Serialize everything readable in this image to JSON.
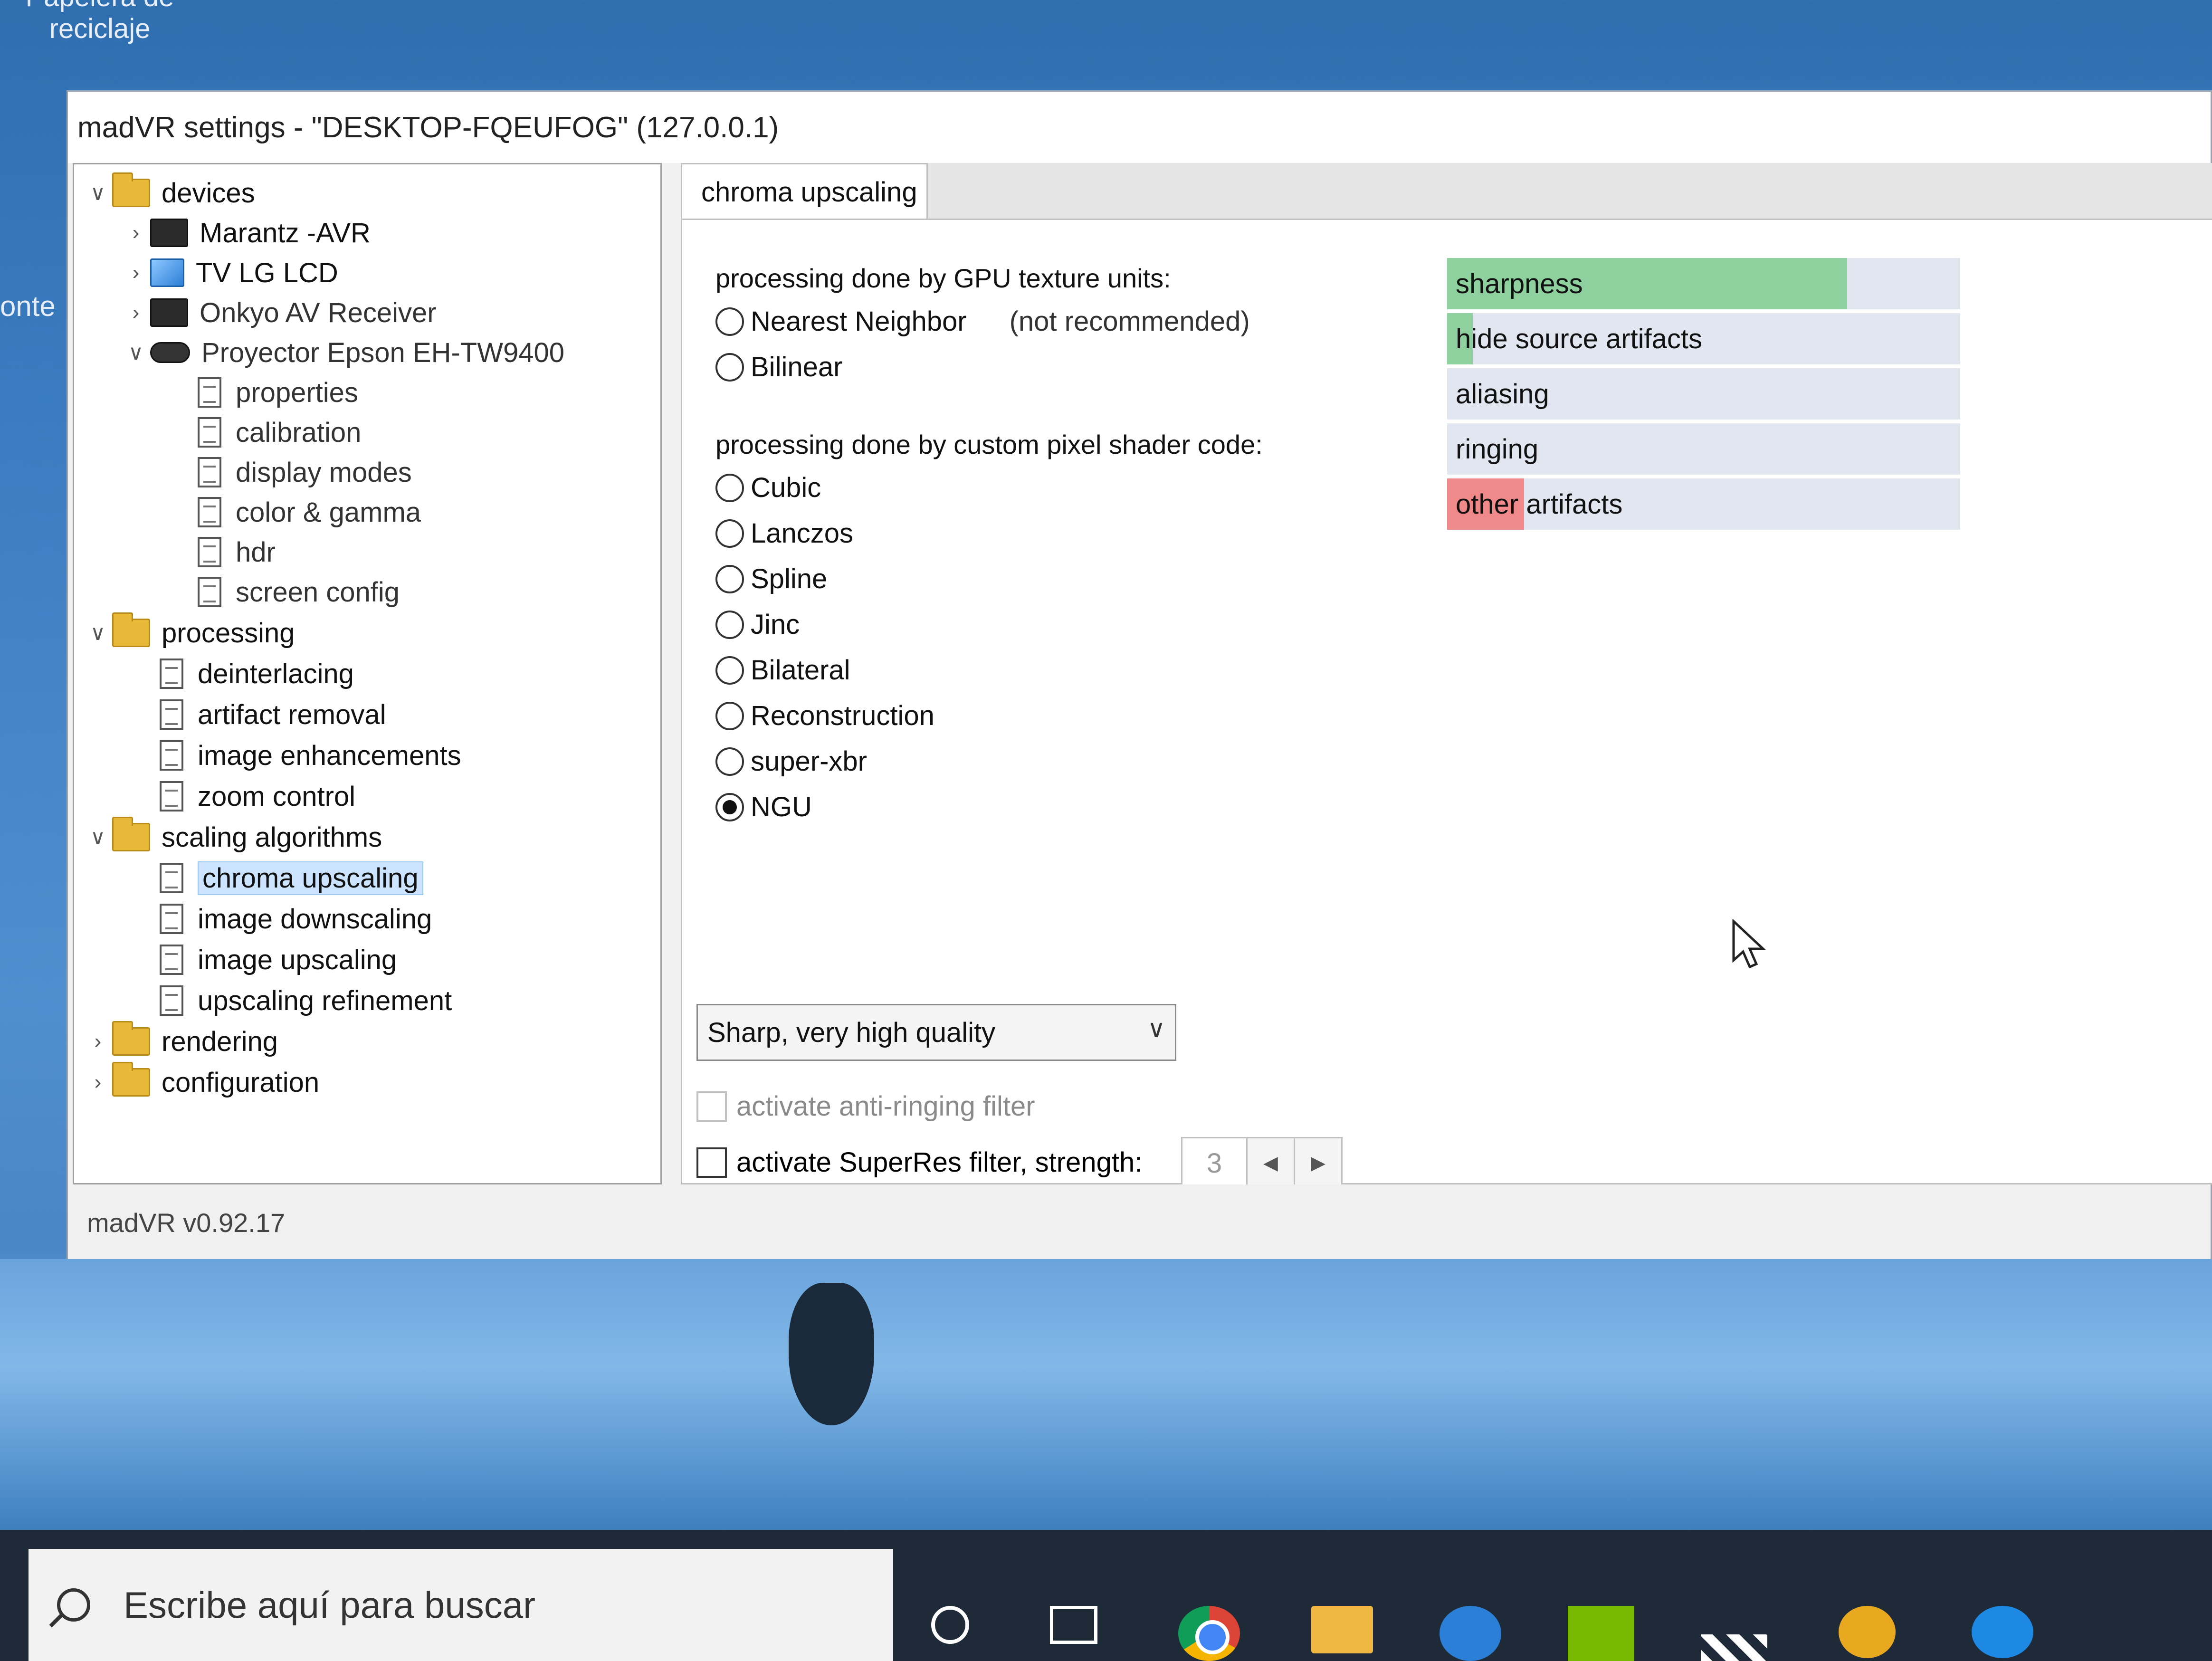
{
  "desktop": {
    "recycle_bin_label_line1": "Papelera de",
    "recycle_bin_label_line2": "reciclaje",
    "cut_label": "onte"
  },
  "window": {
    "title": "madVR settings - \"DESKTOP-FQEUFOG\" (127.0.0.1)",
    "status": "madVR v0.92.17"
  },
  "tree": {
    "devices": "devices",
    "marantz": "Marantz -AVR",
    "tv": "TV LG LCD",
    "onkyo": "Onkyo AV Receiver",
    "proyector": "Proyector Epson EH-TW9400",
    "properties": "properties",
    "calibration": "calibration",
    "display_modes": "display modes",
    "color_gamma": "color & gamma",
    "hdr": "hdr",
    "screen_config": "screen config",
    "processing": "processing",
    "deinterlacing": "deinterlacing",
    "artifact_removal": "artifact removal",
    "image_enhancements": "image enhancements",
    "zoom_control": "zoom control",
    "scaling_algorithms": "scaling algorithms",
    "chroma_upscaling": "chroma upscaling",
    "image_downscaling": "image downscaling",
    "image_upscaling": "image upscaling",
    "upscaling_refinement": "upscaling refinement",
    "rendering": "rendering",
    "configuration": "configuration"
  },
  "panel": {
    "tab": "chroma upscaling",
    "gpu_heading": "processing done by GPU texture units:",
    "nearest": "Nearest Neighbor",
    "nearest_note": "(not recommended)",
    "bilinear": "Bilinear",
    "shader_heading": "processing done by custom pixel shader code:",
    "cubic": "Cubic",
    "lanczos": "Lanczos",
    "spline": "Spline",
    "jinc": "Jinc",
    "bilateral": "Bilateral",
    "reconstruction": "Reconstruction",
    "superxbr": "super-xbr",
    "ngu": "NGU",
    "selected_algorithm": "NGU",
    "quality": "Sharp, very high quality",
    "anti_ringing": "activate anti-ringing filter",
    "superres": "activate SuperRes filter, strength:",
    "strength": "3"
  },
  "meters": {
    "sharpness": "sharpness",
    "sharpness_level": 0.78,
    "hide_source_artifacts": "hide source artifacts",
    "hide_level": 0.05,
    "aliasing": "aliasing",
    "ringing": "ringing",
    "other_artifacts": "other artifacts",
    "other_level": 0.15,
    "colors": {
      "good": "#8fd19e",
      "bad": "#f08a8a",
      "track": "#e2e6f0"
    }
  },
  "taskbar": {
    "search_placeholder": "Escribe aquí para buscar"
  }
}
